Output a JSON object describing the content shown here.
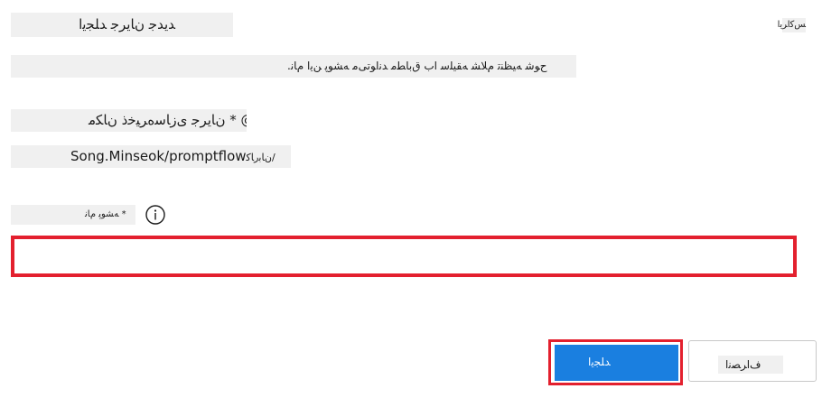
{
  "dialog": {
    "title": "ﺪﻳﺪﺟ ﻥﺎﻳﺮﺟ ﺪﻠﺠﻳﺍ",
    "close_label": "ﺲﻛﺍﺮﻳﺍ",
    "description": "ﺡﻮﺷ ﻪﻴﻈﻨﺗ ﻡﻼﺸ ﻪﻘﻴﻠﺳ ﺍﺏ ﻕﺑﺎﻄﻣ ﺪﻧﺍﻮﺗﯽﻣ ﻪﺸﻮﭘ ﻦﻳﺍ ﻡﺎﻧ."
  },
  "repository": {
    "owner_label": "@ * ﻥﺎﻳﺮﺟ ﯼﺯﺎﺳﻩﺮﻴﺧﺫ ﻥﺎﮑﻣ",
    "path_prefix": "ﻥﺎﺑﺭﺎﮐ/",
    "path": "Song.Minseok/promptflow"
  },
  "branch": {
    "label": "* ﻪﺸﻮﭘ ﻡﺎﻧ",
    "info_icon": "info-icon",
    "value": "",
    "placeholder": ""
  },
  "actions": {
    "publish_label": "ﺪﻠﺠﻳﺍ",
    "cancel_label": "ﻑﺍﺮﺼﻧﺍ"
  },
  "colors": {
    "accent": "#1a7fe0",
    "highlight": "#e3202e",
    "label_bg": "#f0f0f0"
  }
}
